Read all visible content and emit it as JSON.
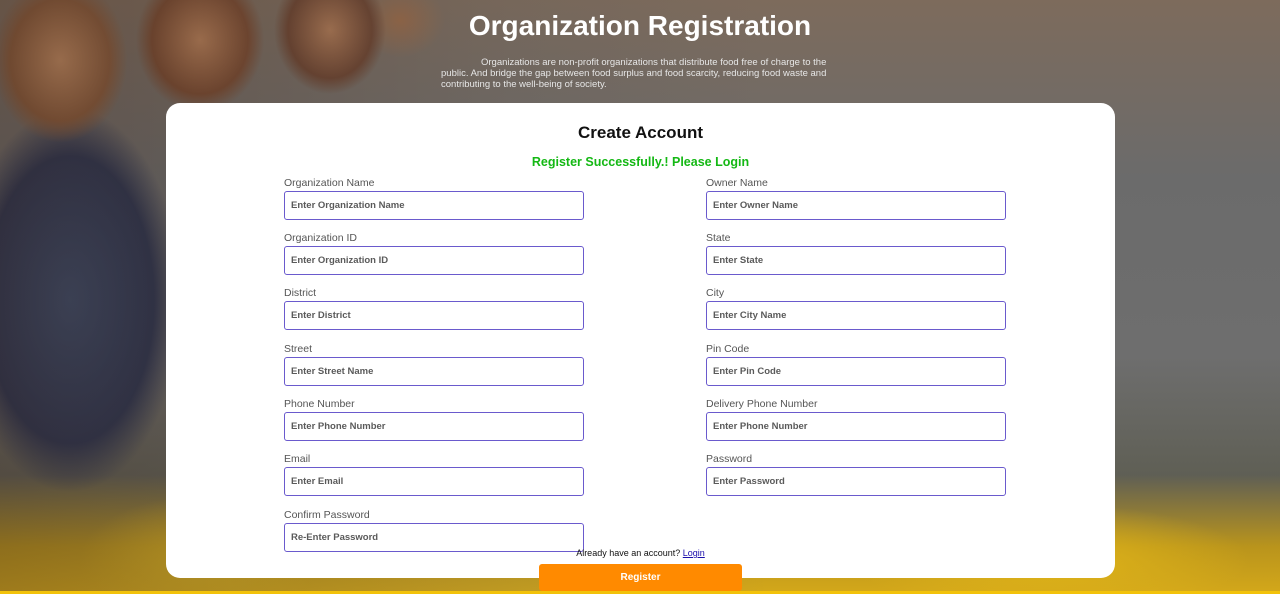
{
  "header": {
    "title": "Organization Registration",
    "description": "Organizations are non-profit organizations that distribute food free of charge to the public. And bridge the gap between food surplus and food scarcity, reducing food waste and contributing to the well-being of society."
  },
  "form": {
    "title": "Create Account",
    "success_message": "Register Successfully.! Please Login",
    "fields": {
      "org_name": {
        "label": "Organization Name",
        "placeholder": "Enter Organization Name",
        "value": ""
      },
      "owner_name": {
        "label": "Owner Name",
        "placeholder": "Enter Owner Name",
        "value": ""
      },
      "org_id": {
        "label": "Organization ID",
        "placeholder": "Enter Organization ID",
        "value": ""
      },
      "state": {
        "label": "State",
        "placeholder": "Enter State",
        "value": ""
      },
      "district": {
        "label": "District",
        "placeholder": "Enter District",
        "value": ""
      },
      "city": {
        "label": "City",
        "placeholder": "Enter City Name",
        "value": ""
      },
      "street": {
        "label": "Street",
        "placeholder": "Enter Street Name",
        "value": ""
      },
      "pin_code": {
        "label": "Pin Code",
        "placeholder": "Enter Pin Code",
        "value": ""
      },
      "phone": {
        "label": "Phone Number",
        "placeholder": "Enter Phone Number",
        "value": ""
      },
      "delivery_phone": {
        "label": "Delivery Phone Number",
        "placeholder": "Enter Phone Number",
        "value": ""
      },
      "email": {
        "label": "Email",
        "placeholder": "Enter Email",
        "value": ""
      },
      "password": {
        "label": "Password",
        "placeholder": "Enter Password",
        "value": ""
      },
      "confirm_password": {
        "label": "Confirm Password",
        "placeholder": "Re-Enter Password",
        "value": ""
      }
    },
    "login_prompt": "Already have an account?",
    "login_link": "Login",
    "register_label": "Register"
  },
  "colors": {
    "accent_button": "#ff8a00",
    "input_border": "#6a5acd",
    "success": "#14b814",
    "link": "#1a0dab"
  }
}
